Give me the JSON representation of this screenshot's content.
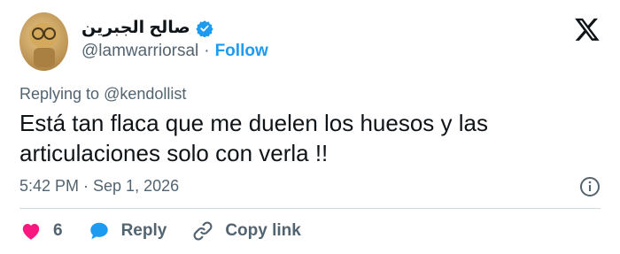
{
  "author": {
    "display_name": "صالح الجبرين",
    "handle": "@lamwarriorsal",
    "separator": "·",
    "follow_label": "Follow"
  },
  "reply": {
    "prefix": "Replying to",
    "mention": "@kendollist"
  },
  "tweet": {
    "text": "Está tan flaca que me duelen los huesos y las articulaciones solo con verla !!",
    "timestamp": "5:42 PM · Sep 1, 2026"
  },
  "actions": {
    "like_count": "6",
    "reply_label": "Reply",
    "copy_link_label": "Copy link"
  },
  "colors": {
    "accent": "#1d9bf0",
    "like": "#f91880",
    "muted": "#536471"
  }
}
